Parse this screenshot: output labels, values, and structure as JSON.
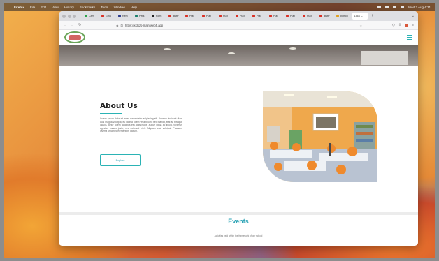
{
  "menubar": {
    "app_name": "Firefox",
    "items": [
      "File",
      "Edit",
      "View",
      "History",
      "Bookmarks",
      "Tools",
      "Window",
      "Help"
    ],
    "clock": "Wed 2 Aug 4:31"
  },
  "browser": {
    "tabs": [
      {
        "label": "Cam",
        "color": "#2aa34a"
      },
      {
        "label": "Gma",
        "color": "#d93025"
      },
      {
        "label": "Rem",
        "color": "#2b3a8c"
      },
      {
        "label": "Pers",
        "color": "#1a7f6b"
      },
      {
        "label": "Form",
        "color": "#222222"
      },
      {
        "label": "aklav",
        "color": "#d93025"
      },
      {
        "label": "Plax",
        "color": "#d93025"
      },
      {
        "label": "Plax",
        "color": "#d93025"
      },
      {
        "label": "Plax",
        "color": "#d93025"
      },
      {
        "label": "Plax",
        "color": "#d93025"
      },
      {
        "label": "Plax",
        "color": "#d93025"
      },
      {
        "label": "Plax",
        "color": "#d93025"
      },
      {
        "label": "Plax",
        "color": "#d93025"
      },
      {
        "label": "Plax",
        "color": "#d93025"
      },
      {
        "label": "aklav",
        "color": "#d93025"
      },
      {
        "label": "python",
        "color": "#e0a020"
      }
    ],
    "active_tab": {
      "label": "Loca",
      "close": "×"
    },
    "new_tab": "+",
    "tab_list": "⌄",
    "url": "https://kidszo-main.web5.app",
    "star": "☆"
  },
  "site": {
    "about": {
      "title": "About Us",
      "body": "Lorem ipsum dolor sit amet consectetur adipiscing elit. Aenean tincidunt diam quis magna volutpat, eu lacinia lorem vestibulum. Sed blandit, erat ac tristique iaculis, tortor lorem faucibus est, quis mollis augue ligula ac ligula. Vivamus egestas cursus justo, nec euismod nibh. Aliquam erat volutpat. Praesent viverra urna nec elementum dictum.",
      "button": "Explore"
    },
    "events": {
      "title": "Events",
      "subtitle": "Activities held within the framework of our school"
    }
  }
}
